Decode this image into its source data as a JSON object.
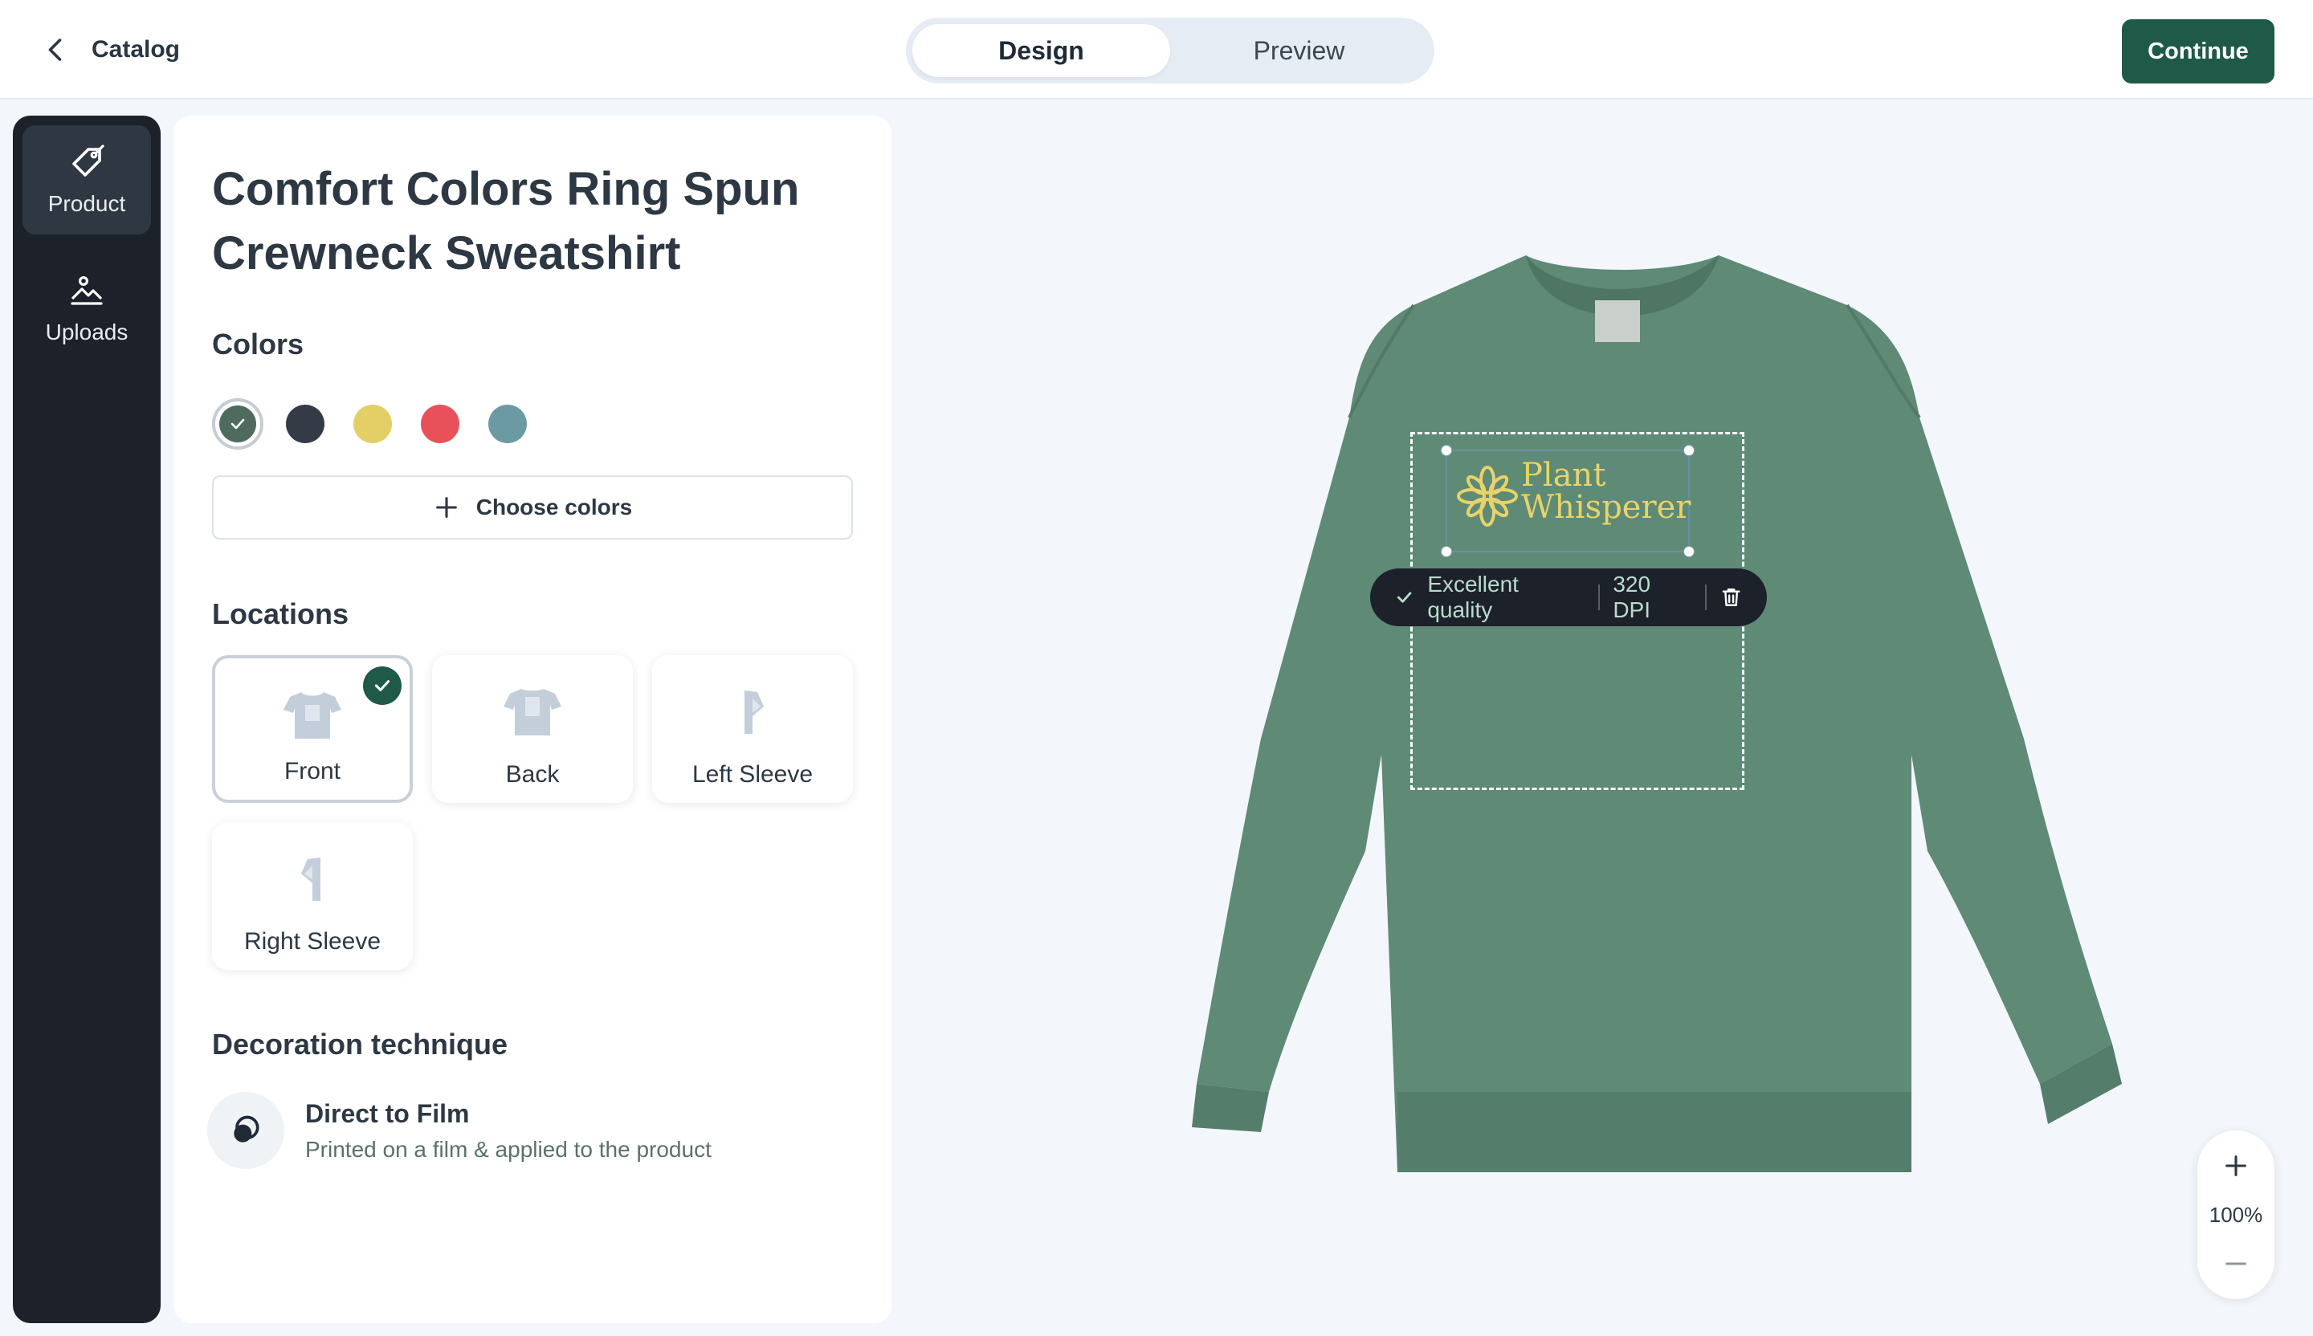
{
  "header": {
    "back_label": "Catalog",
    "tabs": [
      {
        "label": "Design",
        "active": true
      },
      {
        "label": "Preview",
        "active": false
      }
    ],
    "continue_label": "Continue"
  },
  "sidebar": {
    "items": [
      {
        "label": "Product",
        "icon": "tag-icon",
        "active": true
      },
      {
        "label": "Uploads",
        "icon": "image-icon",
        "active": false
      }
    ]
  },
  "product": {
    "title": "Comfort Colors Ring Spun Crewneck Sweatshirt"
  },
  "colors": {
    "title": "Colors",
    "swatches": [
      "#4f6b5f",
      "#343b46",
      "#e3cf65",
      "#e9515a",
      "#6c9aa3"
    ],
    "selected_index": 0,
    "choose_label": "Choose colors"
  },
  "locations": {
    "title": "Locations",
    "items": [
      {
        "label": "Front",
        "selected": true
      },
      {
        "label": "Back",
        "selected": false
      },
      {
        "label": "Left Sleeve",
        "selected": false
      },
      {
        "label": "Right Sleeve",
        "selected": false
      }
    ]
  },
  "decoration": {
    "title": "Decoration technique",
    "name": "Direct to Film",
    "description": "Printed on a film & applied to the product"
  },
  "canvas": {
    "garment_color": "#5e8a76",
    "design_text_line1": "Plant",
    "design_text_line2": "Whisperer",
    "design_color": "#e8d36b",
    "quality_label": "Excellent quality",
    "dpi_label": "320 DPI",
    "zoom_level": "100%"
  }
}
